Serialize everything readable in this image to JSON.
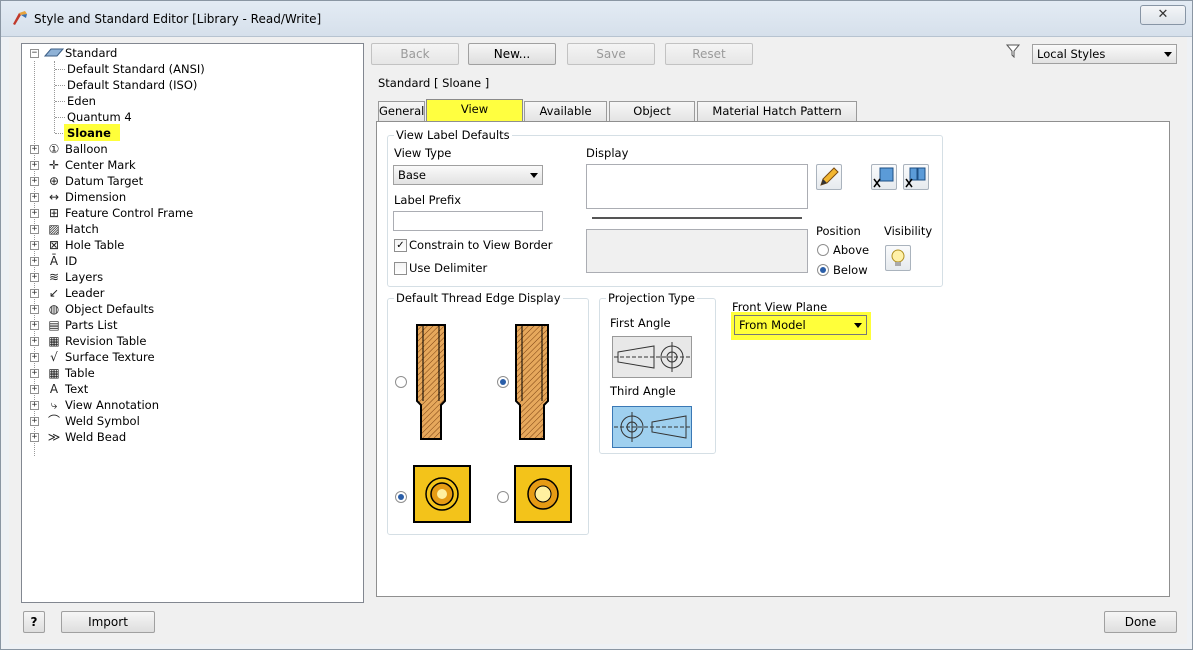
{
  "window": {
    "title": "Style and Standard Editor [Library - Read/Write]",
    "close_glyph": "✕"
  },
  "colors": {
    "highlight": "#ffff3a",
    "selection_bg": "#ffff3a"
  },
  "tree": {
    "root": "Standard",
    "standards": [
      "Default Standard (ANSI)",
      "Default Standard (ISO)",
      "Eden",
      "Quantum 4",
      "Sloane"
    ],
    "selected": "Sloane",
    "categories": [
      {
        "label": "Balloon",
        "icon": "balloon-icon",
        "glyph": "①"
      },
      {
        "label": "Center Mark",
        "icon": "center-mark-icon",
        "glyph": "✛"
      },
      {
        "label": "Datum Target",
        "icon": "datum-target-icon",
        "glyph": "⊕"
      },
      {
        "label": "Dimension",
        "icon": "dimension-icon",
        "glyph": "↔"
      },
      {
        "label": "Feature Control Frame",
        "icon": "feature-control-frame-icon",
        "glyph": "⊞"
      },
      {
        "label": "Hatch",
        "icon": "hatch-icon",
        "glyph": "▨"
      },
      {
        "label": "Hole Table",
        "icon": "hole-table-icon",
        "glyph": "⊠"
      },
      {
        "label": "ID",
        "icon": "id-icon",
        "glyph": "Ā"
      },
      {
        "label": "Layers",
        "icon": "layers-icon",
        "glyph": "≋"
      },
      {
        "label": "Leader",
        "icon": "leader-icon",
        "glyph": "↙"
      },
      {
        "label": "Object Defaults",
        "icon": "object-defaults-icon",
        "glyph": "◍"
      },
      {
        "label": "Parts List",
        "icon": "parts-list-icon",
        "glyph": "▤"
      },
      {
        "label": "Revision Table",
        "icon": "revision-table-icon",
        "glyph": "▦"
      },
      {
        "label": "Surface Texture",
        "icon": "surface-texture-icon",
        "glyph": "√"
      },
      {
        "label": "Table",
        "icon": "table-icon",
        "glyph": "▦"
      },
      {
        "label": "Text",
        "icon": "text-icon",
        "glyph": "A"
      },
      {
        "label": "View Annotation",
        "icon": "view-annotation-icon",
        "glyph": "⤷"
      },
      {
        "label": "Weld Symbol",
        "icon": "weld-symbol-icon",
        "glyph": "⌒"
      },
      {
        "label": "Weld Bead",
        "icon": "weld-bead-icon",
        "glyph": "≫"
      }
    ]
  },
  "toolbar": {
    "back": "Back",
    "new": "New...",
    "save": "Save",
    "reset": "Reset",
    "filter_value": "Local Styles"
  },
  "style_header": "Standard [ Sloane ]",
  "tabs": [
    "General",
    "View Preferences",
    "Available Styles",
    "Object Defaults",
    "Material Hatch Pattern Defaults"
  ],
  "active_tab": "View Preferences",
  "view_label": {
    "group_title": "View Label Defaults",
    "view_type_label": "View Type",
    "view_type_value": "Base",
    "label_prefix_label": "Label Prefix",
    "label_prefix_value": "",
    "constrain_label": "Constrain to View Border",
    "constrain_checked": true,
    "delimiter_label": "Use Delimiter",
    "delimiter_checked": false,
    "display_label": "Display",
    "position_label": "Position",
    "above_label": "Above",
    "below_label": "Below",
    "position_value": "Below",
    "visibility_label": "Visibility"
  },
  "thread": {
    "group_title": "Default Thread Edge Display"
  },
  "projection": {
    "group_title": "Projection Type",
    "first_angle": "First Angle",
    "third_angle": "Third Angle",
    "selected": "Third Angle"
  },
  "front_view": {
    "label": "Front View Plane",
    "value": "From Model"
  },
  "footer": {
    "help_glyph": "?",
    "import": "Import",
    "done": "Done"
  }
}
